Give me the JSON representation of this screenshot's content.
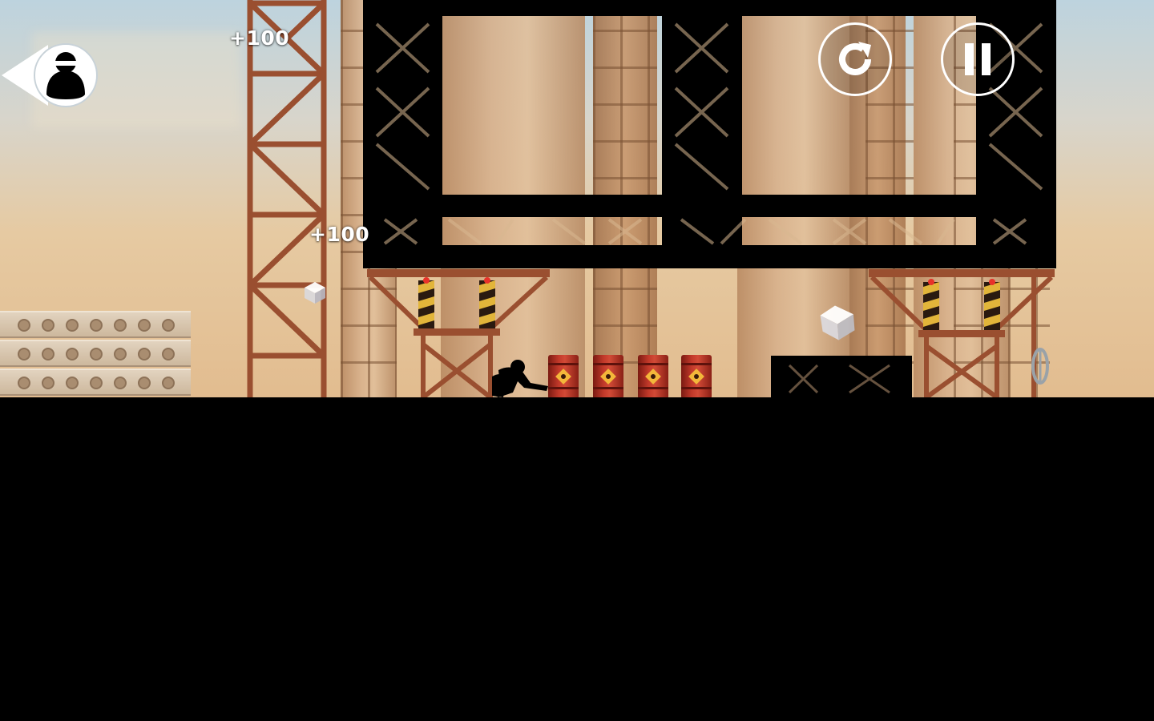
{
  "hud": {
    "back_icon": "chase-back-arrow-icon",
    "chaser_icon": "hunter-silhouette-icon",
    "restart_icon": "restart-icon",
    "pause_icon": "pause-icon"
  },
  "score_popups": [
    {
      "text": "+100"
    },
    {
      "text": "+100"
    }
  ],
  "pickups": [
    {
      "name": "bonus-cube"
    },
    {
      "name": "bonus-cube"
    }
  ],
  "scene": {
    "setting": "construction-site",
    "barrels": 4,
    "colors": {
      "sky_top": "#bdd3de",
      "sky_bottom": "#e2bc8f",
      "crane": "#9a4f30",
      "steel": "#000000",
      "barrel": "#c2392a",
      "hud": "#ffffff"
    }
  }
}
